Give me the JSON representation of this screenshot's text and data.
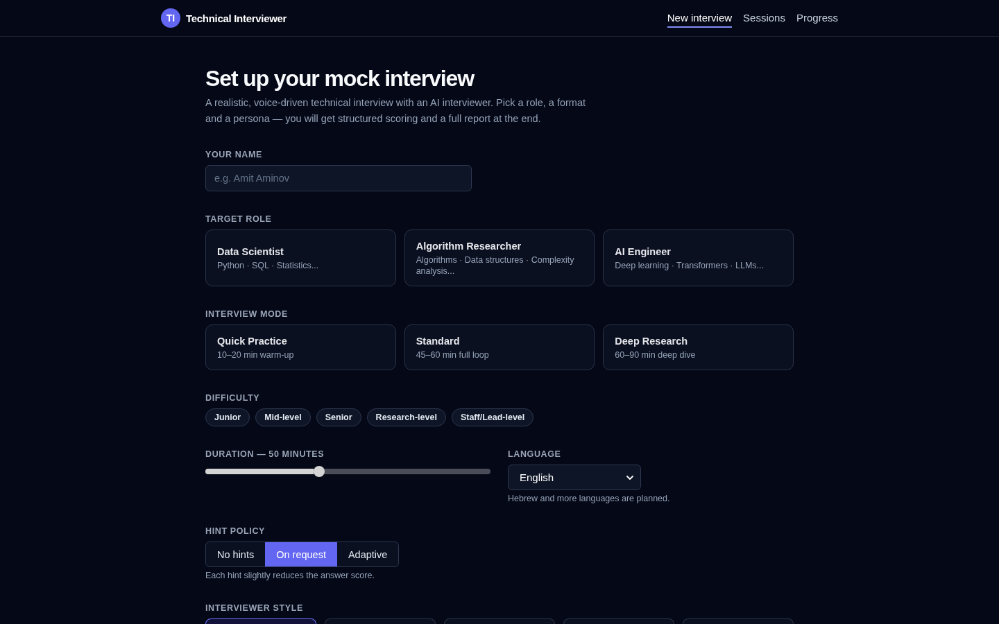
{
  "header": {
    "logo_text": "TI",
    "title": "Technical Interviewer",
    "nav": [
      {
        "label": "New interview",
        "selected": true
      },
      {
        "label": "Sessions",
        "selected": false
      },
      {
        "label": "Progress",
        "selected": false
      }
    ]
  },
  "page": {
    "title": "Set up your mock interview",
    "description": "A realistic, voice-driven technical interview with an AI interviewer. Pick a role, a format and a persona — you will get structured scoring and a full report at the end."
  },
  "name_field": {
    "label": "YOUR NAME",
    "placeholder": "e.g. Amit Aminov"
  },
  "target_role": {
    "label": "TARGET ROLE",
    "options": [
      {
        "title": "Data Scientist",
        "subtitle": "Python · SQL · Statistics...",
        "selected": false
      },
      {
        "title": "Algorithm Researcher",
        "subtitle": "Algorithms · Data structures · Complexity analysis...",
        "selected": false
      },
      {
        "title": "AI Engineer",
        "subtitle": "Deep learning · Transformers · LLMs...",
        "selected": false
      }
    ]
  },
  "interview_mode": {
    "label": "INTERVIEW MODE",
    "options": [
      {
        "title": "Quick Practice",
        "subtitle": "10–20 min warm-up",
        "selected": false
      },
      {
        "title": "Standard",
        "subtitle": "45–60 min full loop",
        "selected": false
      },
      {
        "title": "Deep Research",
        "subtitle": "60–90 min deep dive",
        "selected": false
      }
    ]
  },
  "difficulty": {
    "label": "DIFFICULTY",
    "options": [
      {
        "label": "Junior",
        "selected": false
      },
      {
        "label": "Mid-level",
        "selected": false
      },
      {
        "label": "Senior",
        "selected": false
      },
      {
        "label": "Research-level",
        "selected": false
      },
      {
        "label": "Staff/Lead-level",
        "selected": false
      }
    ]
  },
  "duration": {
    "label": "DURATION — 50 MINUTES",
    "level": 0.4
  },
  "language": {
    "label": "LANGUAGE",
    "value": "English",
    "note": "Hebrew and more languages are planned."
  },
  "hint_policy": {
    "label": "HINT POLICY",
    "options": [
      {
        "label": "No hints",
        "selected": false
      },
      {
        "label": "On request",
        "selected": true
      },
      {
        "label": "Adaptive",
        "selected": false
      }
    ],
    "note": "Each hint slightly reduces the answer score."
  },
  "interviewer_style": {
    "label": "INTERVIEWER STYLE",
    "options": [
      {
        "selected": true
      },
      {
        "selected": false
      },
      {
        "selected": false
      },
      {
        "selected": false
      },
      {
        "selected": false
      }
    ]
  }
}
